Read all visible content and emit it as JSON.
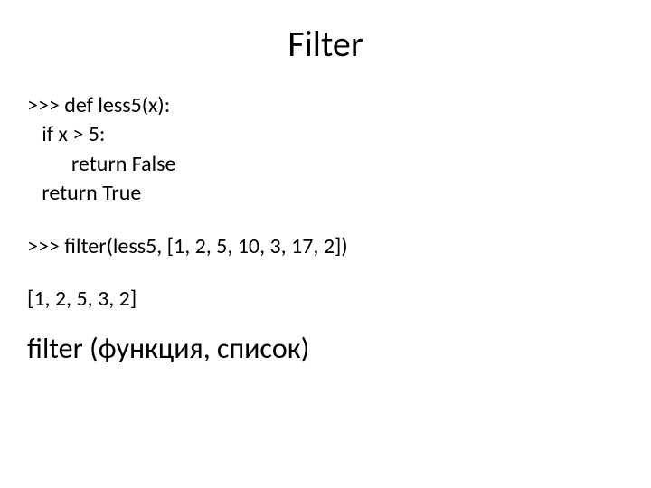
{
  "title": "Filter",
  "code": {
    "line1": ">>> def less5(x):",
    "line2": "   if x > 5:",
    "line3": "         return False",
    "line4": "   return True"
  },
  "call": ">>> filter(less5, [1, 2, 5, 10, 3, 17, 2])",
  "result": "[1, 2, 5, 3, 2]",
  "summary": "filter (функция, список)"
}
